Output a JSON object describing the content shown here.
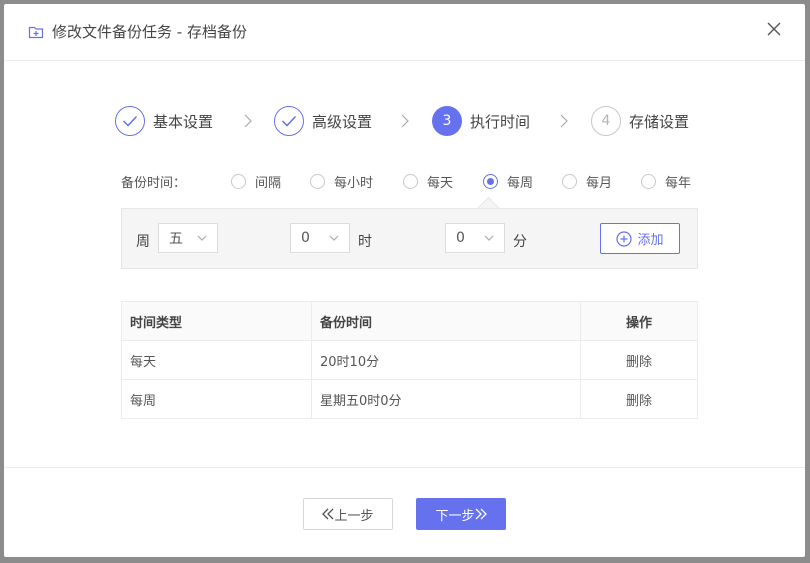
{
  "dialog": {
    "title": "修改文件备份任务 - 存档备份",
    "icon": "folder-add-icon",
    "close_icon": "close-icon"
  },
  "steps": [
    {
      "number": "1",
      "label": "基本设置",
      "state": "done"
    },
    {
      "number": "2",
      "label": "高级设置",
      "state": "done"
    },
    {
      "number": "3",
      "label": "执行时间",
      "state": "active"
    },
    {
      "number": "4",
      "label": "存储设置",
      "state": "pending"
    }
  ],
  "frequency": {
    "label": "备份时间：",
    "options": [
      "间隔",
      "每小时",
      "每天",
      "每周",
      "每月",
      "每年"
    ],
    "selected": "每周"
  },
  "schedule": {
    "week_label": "周",
    "week_value": "五",
    "hour_value": "0",
    "hour_unit": "时",
    "minute_value": "0",
    "minute_unit": "分",
    "add_label": "添加"
  },
  "table": {
    "headers": [
      "时间类型",
      "备份时间",
      "操作"
    ],
    "rows": [
      {
        "type": "每天",
        "time": "20时10分",
        "action": "删除"
      },
      {
        "type": "每周",
        "time": "星期五0时0分",
        "action": "删除"
      }
    ]
  },
  "footer": {
    "prev_label": "上一步",
    "next_label": "下一步"
  },
  "colors": {
    "accent": "#6671ee",
    "overlay": "#8c8c8c"
  }
}
